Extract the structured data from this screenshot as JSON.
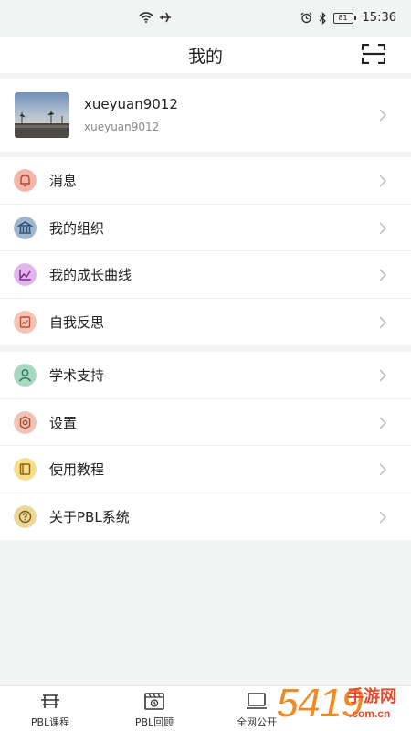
{
  "status_bar": {
    "time": "15:36",
    "battery": "81",
    "icons": [
      "wifi-icon",
      "airplane-icon",
      "alarm-icon",
      "bluetooth-icon",
      "battery-icon"
    ]
  },
  "header": {
    "title": "我的",
    "scan_icon": "scan-icon"
  },
  "profile": {
    "name": "xueyuan9012",
    "account": "xueyuan9012"
  },
  "menu_group_1": [
    {
      "label": "消息",
      "icon": "bell-icon",
      "color": "#e88a7a"
    },
    {
      "label": "我的组织",
      "icon": "bank-icon",
      "color": "#5b7fa8"
    },
    {
      "label": "我的成长曲线",
      "icon": "chart-icon",
      "color": "#c87bd6"
    },
    {
      "label": "自我反思",
      "icon": "note-icon",
      "color": "#ec9c86"
    }
  ],
  "menu_group_2": [
    {
      "label": "学术支持",
      "icon": "user-icon",
      "color": "#5fae8a"
    },
    {
      "label": "设置",
      "icon": "gear-icon",
      "color": "#d98c7c"
    },
    {
      "label": "使用教程",
      "icon": "book-icon",
      "color": "#e9b93e"
    },
    {
      "label": "关于PBL系统",
      "icon": "question-icon",
      "color": "#c9a452"
    }
  ],
  "tabs": [
    {
      "label": "PBL课程",
      "icon": "course-icon"
    },
    {
      "label": "PBL回顾",
      "icon": "review-icon"
    },
    {
      "label": "全网公开",
      "icon": "public-icon"
    }
  ],
  "watermark": {
    "number": "5419",
    "text": "手游网",
    "domain": ".com.cn"
  }
}
